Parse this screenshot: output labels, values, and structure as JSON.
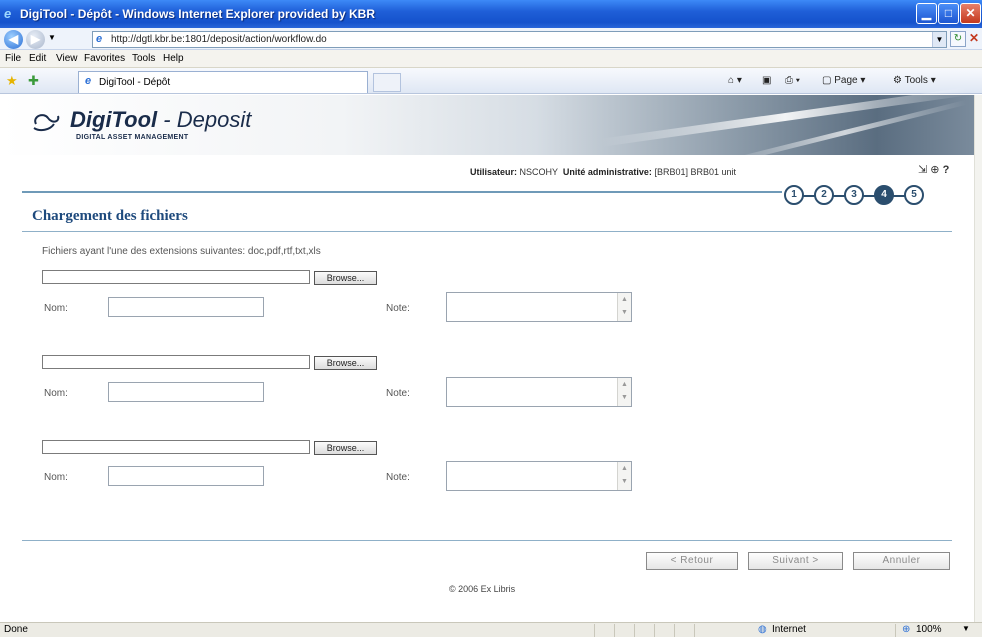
{
  "window": {
    "title": "DigiTool - Dépôt - Windows Internet Explorer provided by KBR",
    "minimize": "▁",
    "maximize": "□",
    "close": "✕"
  },
  "address": {
    "url": "http://dgtl.kbr.be:1801/deposit/action/workflow.do"
  },
  "menu": [
    "File",
    "Edit",
    "View",
    "Favorites",
    "Tools",
    "Help"
  ],
  "tab": {
    "label": "DigiTool - Dépôt"
  },
  "commands": {
    "page": "Page",
    "tools": "Tools"
  },
  "banner": {
    "brand_bold": "DigiTool",
    "brand_rest": " - Deposit",
    "subtitle": "DIGITAL ASSET MANAGEMENT"
  },
  "user": {
    "user_label": "Utilisateur:",
    "user_value": "NSCOHY",
    "unit_label": "Unité administrative:",
    "unit_value": "[BRB01] BRB01 unit"
  },
  "steps": [
    "1",
    "2",
    "3",
    "4",
    "5"
  ],
  "active_step": 4,
  "page": {
    "title": "Chargement des fichiers",
    "instructions": "Fichiers ayant l'une des extensions suivantes: doc,pdf,rtf,txt,xls"
  },
  "form": {
    "browse_label": "Browse...",
    "name_label": "Nom:",
    "note_label": "Note:"
  },
  "buttons": {
    "back": "< Retour",
    "next": "Suivant >",
    "cancel": "Annuler"
  },
  "footer": {
    "copyright": "© 2006 Ex Libris"
  },
  "status": {
    "left": "Done",
    "zone": "Internet",
    "zoom": "100%"
  },
  "colors": {
    "title_bar": "#1f5fd8",
    "heading": "#1e4a7d",
    "rule": "#6f9ab8",
    "step": "#2b4e6e"
  }
}
